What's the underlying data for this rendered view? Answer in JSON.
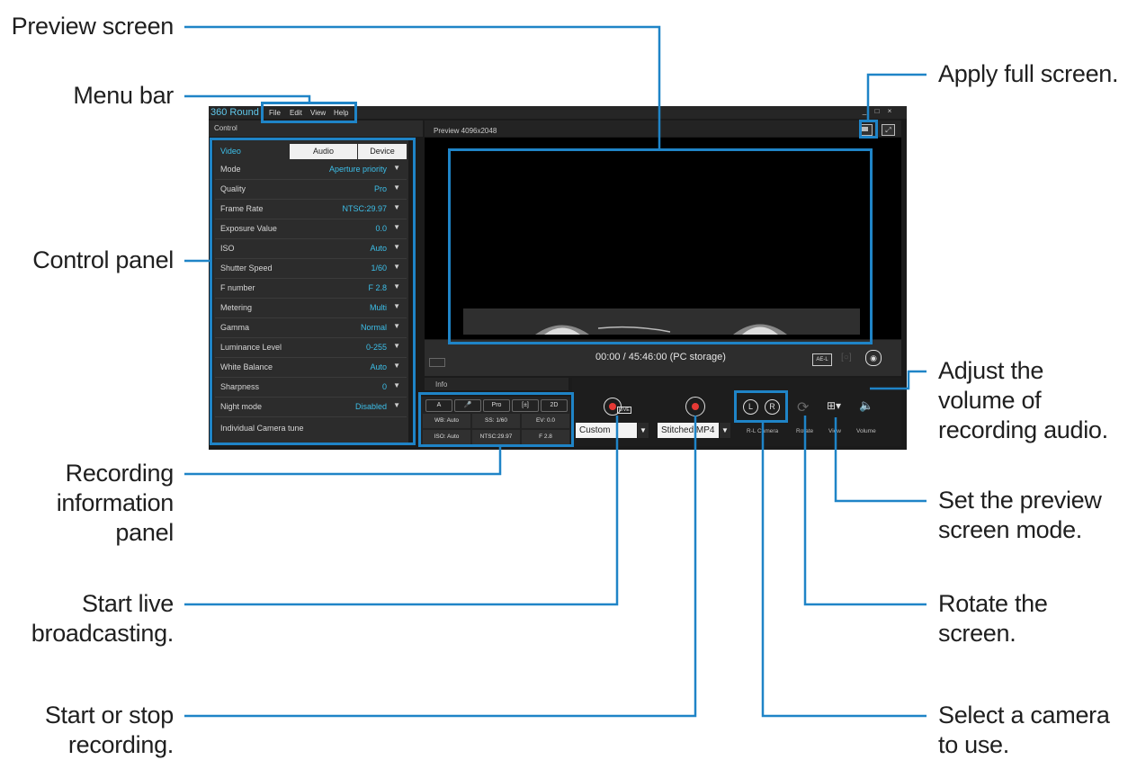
{
  "app": {
    "title": "360 Round",
    "menu": [
      "File",
      "Edit",
      "View",
      "Help"
    ],
    "window_buttons": [
      "_",
      "□",
      "×"
    ],
    "control_header": "Control"
  },
  "control_panel": {
    "tabs": [
      "Video",
      "Audio",
      "Device"
    ],
    "active_tab": "Video",
    "rows": [
      {
        "label": "Mode",
        "value": "Aperture priority"
      },
      {
        "label": "Quality",
        "value": "Pro"
      },
      {
        "label": "Frame Rate",
        "value": "NTSC:29.97"
      },
      {
        "label": "Exposure Value",
        "value": "0.0"
      },
      {
        "label": "ISO",
        "value": "Auto"
      },
      {
        "label": "Shutter Speed",
        "value": "1/60"
      },
      {
        "label": "F number",
        "value": "F 2.8"
      },
      {
        "label": "Metering",
        "value": "Multi"
      },
      {
        "label": "Gamma",
        "value": "Normal"
      },
      {
        "label": "Luminance Level",
        "value": "0-255"
      },
      {
        "label": "White Balance",
        "value": "Auto"
      },
      {
        "label": "Sharpness",
        "value": "0"
      },
      {
        "label": "Night mode",
        "value": "Disabled"
      },
      {
        "label": "Individual Camera tune",
        "value": ""
      }
    ]
  },
  "preview": {
    "title": "Preview 4096x2048",
    "time": "00:00 / 45:46:00 (PC storage)"
  },
  "info": {
    "tab": "Info",
    "chips": [
      "A",
      "🎤",
      "Pro",
      "[±]",
      "2D"
    ],
    "cells": [
      "WB: Auto",
      "SS: 1/60",
      "EV: 0.0",
      "ISO: Auto",
      "NTSC:29.97",
      "F 2.8"
    ]
  },
  "toolbar": {
    "broadcast_preset": "Custom",
    "record_format": "Stitched MP4",
    "labels": [
      "R-L Camera",
      "Rotate",
      "View",
      "Volume"
    ],
    "live_label": "LIVE"
  },
  "callouts": {
    "preview_screen": "Preview screen",
    "menu_bar": "Menu bar",
    "control_panel": "Control panel",
    "recording_info": [
      "Recording",
      "information",
      "panel"
    ],
    "start_live": [
      "Start live",
      "broadcasting."
    ],
    "start_stop": [
      "Start or stop",
      "recording."
    ],
    "apply_full": "Apply full screen.",
    "adjust_volume": [
      "Adjust the",
      "volume of",
      "recording audio."
    ],
    "set_preview": [
      "Set the preview",
      "screen mode."
    ],
    "rotate": [
      "Rotate the",
      "screen."
    ],
    "select_camera": [
      "Select a camera",
      "to use."
    ]
  },
  "colors": {
    "leader": "#1f84c7",
    "accent": "#3dbfe9",
    "record_red": "#e53935"
  }
}
